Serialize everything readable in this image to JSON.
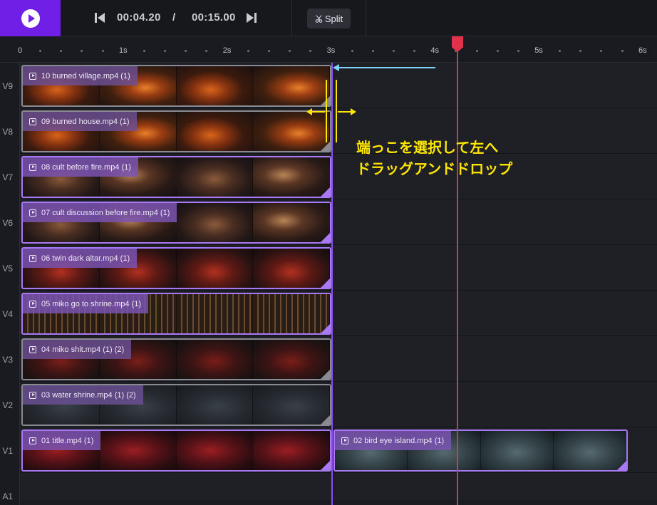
{
  "toolbar": {
    "current_time": "00:04.20",
    "separator": "/",
    "duration": "00:15.00",
    "split_label": "Split"
  },
  "ruler": {
    "labels": [
      "0",
      "1s",
      "2s",
      "3s",
      "4s",
      "5s",
      "6s"
    ]
  },
  "playhead_time_s": 4.2,
  "tracks": [
    {
      "label": "V9",
      "clips": [
        {
          "name": "10 burned village.mp4 (1)",
          "style": "fire",
          "selected": false
        }
      ]
    },
    {
      "label": "V8",
      "clips": [
        {
          "name": "09 burned house.mp4 (1)",
          "style": "fire",
          "selected": false
        }
      ]
    },
    {
      "label": "V7",
      "clips": [
        {
          "name": "08 cult before fire.mp4 (1)",
          "style": "candle",
          "selected": true
        }
      ]
    },
    {
      "label": "V6",
      "clips": [
        {
          "name": "07 cult discussion before fire.mp4 (1)",
          "style": "candle",
          "selected": true
        }
      ]
    },
    {
      "label": "V5",
      "clips": [
        {
          "name": "06 twin dark altar.mp4 (1)",
          "style": "altar",
          "selected": true
        }
      ]
    },
    {
      "label": "V4",
      "clips": [
        {
          "name": "05 miko go to shrine.mp4 (1)",
          "style": "lights",
          "selected": true
        }
      ]
    },
    {
      "label": "V3",
      "clips": [
        {
          "name": "04 miko shit.mp4 (1) (2)",
          "style": "redroom",
          "selected": false
        }
      ]
    },
    {
      "label": "V2",
      "clips": [
        {
          "name": "03 water shrine.mp4 (1) (2)",
          "style": "night",
          "selected": false
        }
      ]
    },
    {
      "label": "V1",
      "clips": [
        {
          "name": "01 title.mp4 (1)",
          "style": "title",
          "selected": true
        },
        {
          "name": "02 bird eye island.mp4 (1)",
          "style": "island",
          "selected": true
        }
      ]
    },
    {
      "label": "A1",
      "clips": []
    }
  ],
  "annotation": {
    "line1": "端っこを選択して左へ",
    "line2": "ドラッグアンドドロップ",
    "color": "#ffe600"
  },
  "colors": {
    "accent": "#6f1fe6",
    "playhead": "#e0324a",
    "selection": "#a979f5",
    "arrow": "#7fd4ff"
  }
}
